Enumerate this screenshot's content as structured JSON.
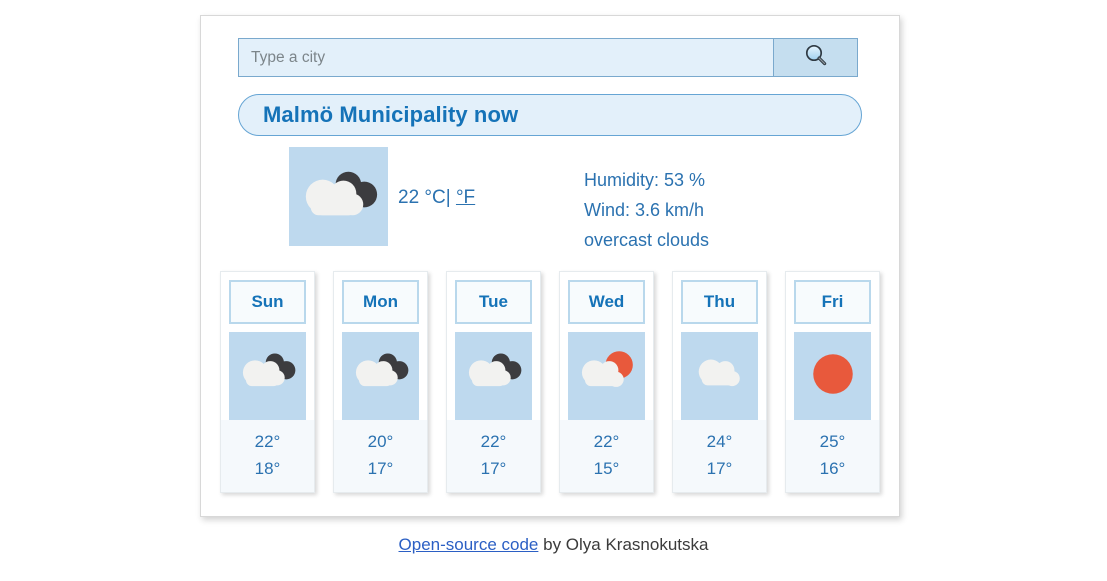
{
  "search": {
    "placeholder": "Type a city",
    "value": "",
    "button_icon": "search-icon"
  },
  "city_banner": {
    "text": "Malmö Municipality now"
  },
  "current": {
    "icon": "overcast-clouds-icon",
    "temperature": "22 °C",
    "unit_separator": "|",
    "alt_unit": "°F",
    "humidity": "Humidity: 53 %",
    "wind": "Wind: 3.6 km/h",
    "description": "overcast clouds"
  },
  "forecast": {
    "days": [
      {
        "label": "Sun",
        "icon": "overcast-clouds-icon",
        "high": "22°",
        "low": "18°"
      },
      {
        "label": "Mon",
        "icon": "overcast-clouds-icon",
        "high": "20°",
        "low": "17°"
      },
      {
        "label": "Tue",
        "icon": "overcast-clouds-icon",
        "high": "22°",
        "low": "17°"
      },
      {
        "label": "Wed",
        "icon": "sun-behind-cloud-icon",
        "high": "22°",
        "low": "15°"
      },
      {
        "label": "Thu",
        "icon": "cloud-icon",
        "high": "24°",
        "low": "17°"
      },
      {
        "label": "Fri",
        "icon": "sun-icon",
        "high": "25°",
        "low": "16°"
      }
    ]
  },
  "footer": {
    "link_text": "Open-source code",
    "rest_text": " by Olya Krasnokutska"
  },
  "colors": {
    "accent_blue": "#1573b8",
    "text_blue": "#2b72b0",
    "panel_blue": "#bed9ee",
    "field_blue": "#e3f0fa",
    "button_blue": "#c5deef",
    "sun_orange": "#e8593c",
    "cloud_white": "#f2f2f0",
    "cloud_dark": "#3c3c3f",
    "link_blue": "#2b5fc4"
  }
}
